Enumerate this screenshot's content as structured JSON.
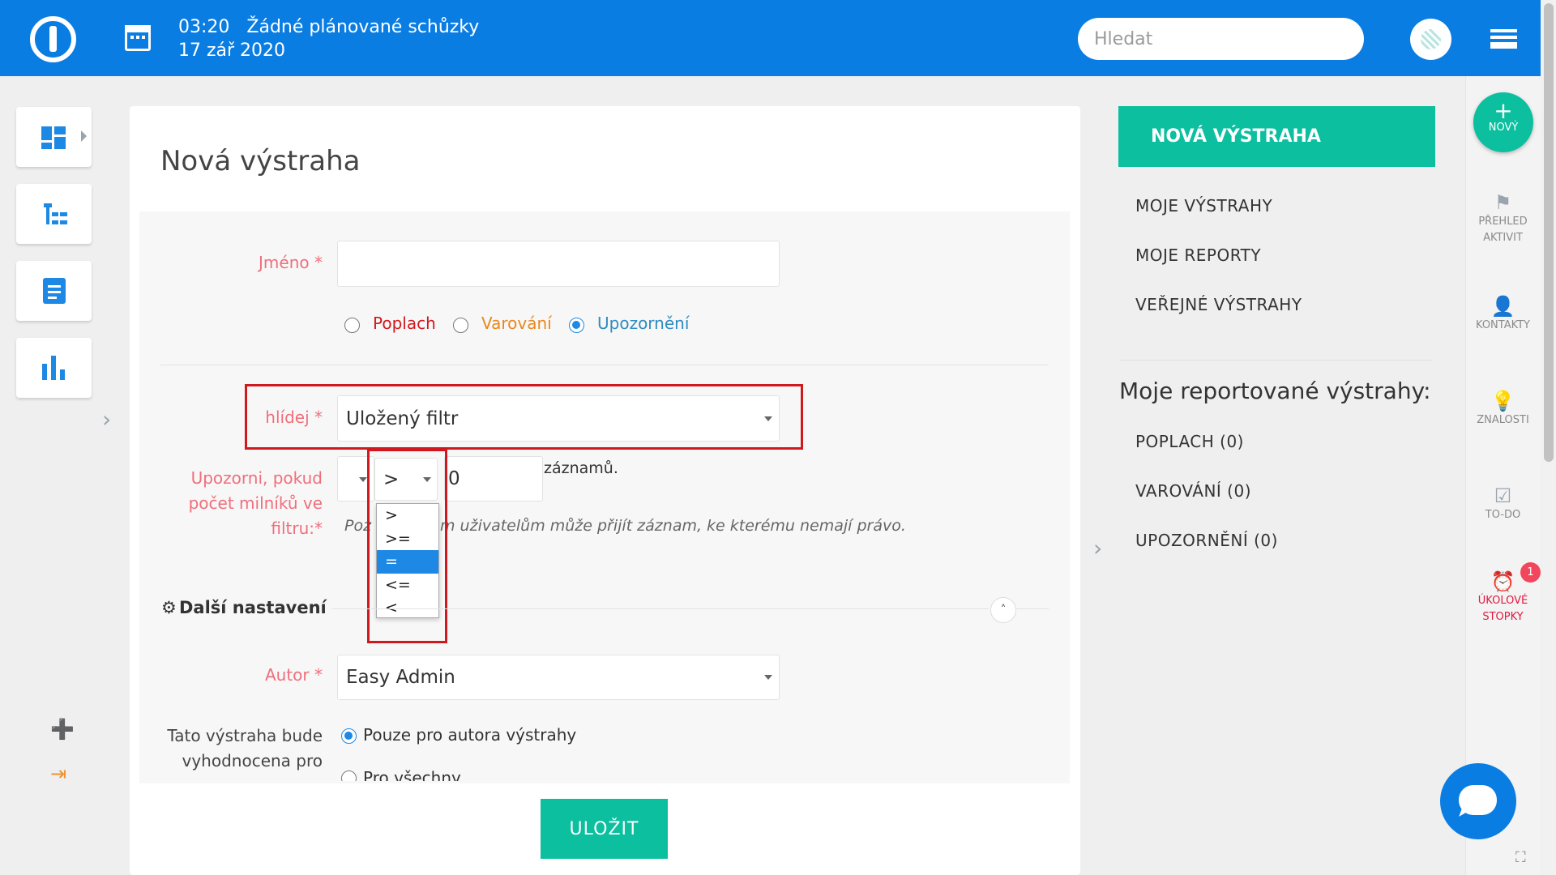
{
  "topbar": {
    "time": "03:20",
    "meeting_status": "Žádné plánované schůzky",
    "date": "17 zář 2020",
    "search_placeholder": "Hledat"
  },
  "card": {
    "title": "Nová výstraha"
  },
  "form": {
    "name_label": "Jméno *",
    "name_value": "",
    "alert_types": [
      "Poplach",
      "Varování",
      "Upozornění"
    ],
    "alert_type_selected": "Upozornění",
    "watch_label": "hlídej *",
    "watch_value": "Uložený filtr",
    "condition_label_lines": [
      "Upozorni, pokud",
      "počet milníků ve",
      "filtru:*"
    ],
    "operator_value": ">",
    "count_value": "0",
    "count_suffix": "záznamů.",
    "hint_prefix": "Poz",
    "hint_text": "m uživatelům může přijít záznam, ke kterému nemají právo.",
    "operator_options": [
      ">",
      ">=",
      "=",
      "<=",
      "<"
    ],
    "operator_highlighted": "=",
    "more_settings_label": "Další nastavení",
    "author_label": "Autor *",
    "author_value": "Easy Admin",
    "evaluated_label_lines": [
      "Tato výstraha bude",
      "vyhodnocena pro"
    ],
    "evaluated_options": [
      "Pouze pro autora výstrahy",
      "Pro všechny"
    ],
    "evaluated_selected": "Pouze pro autora výstrahy",
    "save_label": "ULOŽIT"
  },
  "right_panel": {
    "new_alert": "NOVÁ VÝSTRAHA",
    "links": [
      "MOJE VÝSTRAHY",
      "MOJE REPORTY",
      "VEŘEJNÉ VÝSTRAHY"
    ],
    "reported_title": "Moje reportované výstrahy:",
    "reported": [
      "POPLACH (0)",
      "VAROVÁNÍ (0)",
      "UPOZORNĚNÍ (0)"
    ]
  },
  "rail": {
    "new_label": "NOVÝ",
    "activity_line1": "PŘEHLED",
    "activity_line2": "AKTIVIT",
    "contacts": "KONTAKTY",
    "knowledge": "ZNALOSTI",
    "todo": "TO-DO",
    "timer_line1": "ÚKOLOVÉ",
    "timer_line2": "STOPKY",
    "timer_badge": "1"
  },
  "colors": {
    "brand_blue": "#0a7de3",
    "accent_green": "#0bbf9f",
    "label_red": "#ef6f7c",
    "highlight_red": "#d0191f"
  }
}
